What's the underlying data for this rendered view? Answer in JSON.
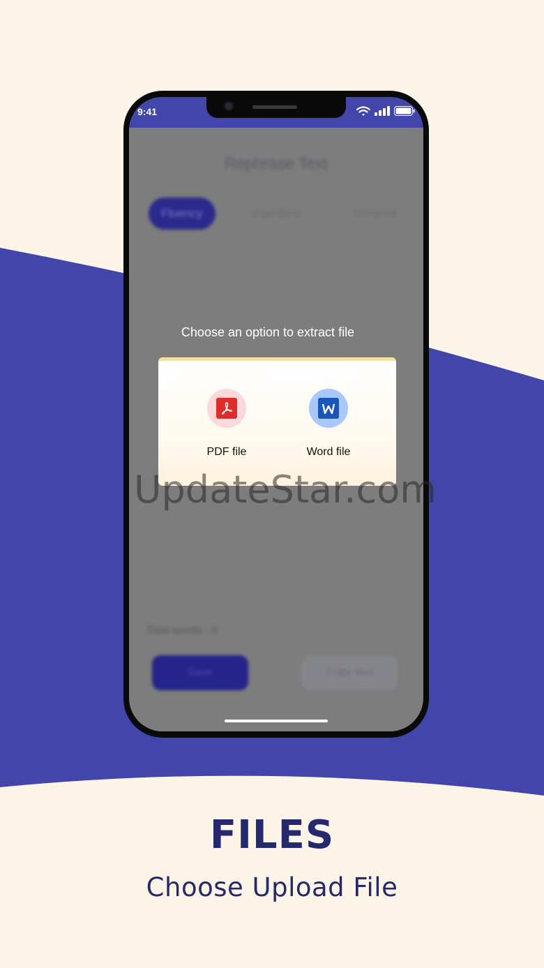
{
  "colors": {
    "background": "#fdf4e8",
    "accent_band": "#4246aa",
    "caption_text": "#26286e",
    "phone_frame": "#0a0a0a"
  },
  "status_bar": {
    "time": "9:41",
    "icons": [
      "wifi-icon",
      "signal-icon",
      "battery-icon"
    ]
  },
  "app": {
    "title": "Rephrase Text",
    "modes": [
      {
        "label": "Fluency",
        "active": true
      },
      {
        "label": "Standard",
        "active": false
      },
      {
        "label": "Creative",
        "active": false
      }
    ],
    "total_words_label": "Total words : 0",
    "save_label": "Save",
    "copy_label": "Copy text"
  },
  "dialog": {
    "title": "Choose an option to extract file",
    "options": [
      {
        "label": "PDF file",
        "icon": "pdf-file-icon"
      },
      {
        "label": "Word file",
        "icon": "word-file-icon"
      }
    ]
  },
  "watermark": "UpdateStar.com",
  "caption": {
    "title": "FILES",
    "subtitle": "Choose Upload File"
  }
}
